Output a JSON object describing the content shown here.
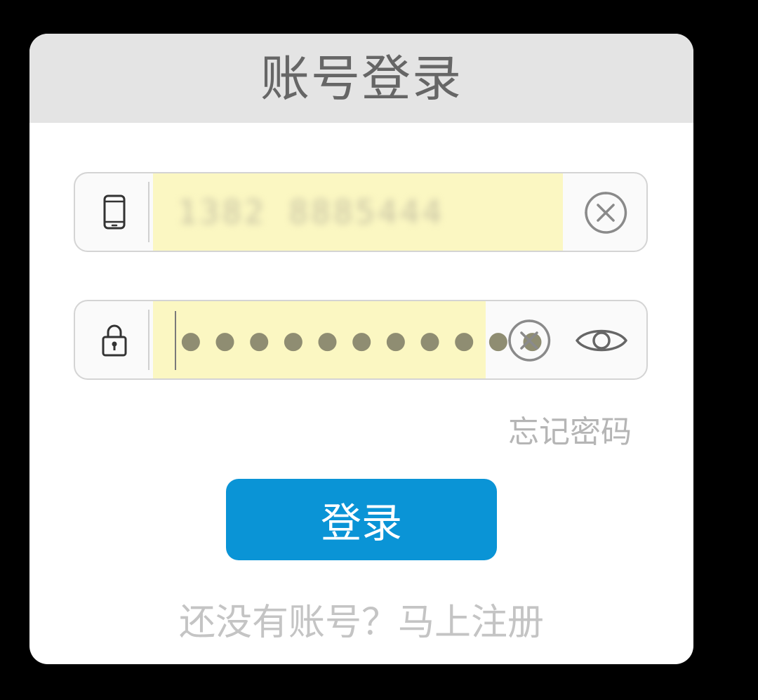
{
  "dialog": {
    "title": "账号登录"
  },
  "phone_field": {
    "icon": "phone-icon",
    "value": "1382 8885444",
    "clear_icon": "clear-circle-icon"
  },
  "password_field": {
    "icon": "lock-icon",
    "masked_value": "●●●●●●●●●●●",
    "clear_icon": "clear-circle-icon",
    "toggle_icon": "eye-icon"
  },
  "forgot_password": {
    "label": "忘记密码"
  },
  "login_button": {
    "label": "登录",
    "color": "#0a94d6"
  },
  "register_prompt": {
    "label": "还没有账号？马上注册"
  }
}
